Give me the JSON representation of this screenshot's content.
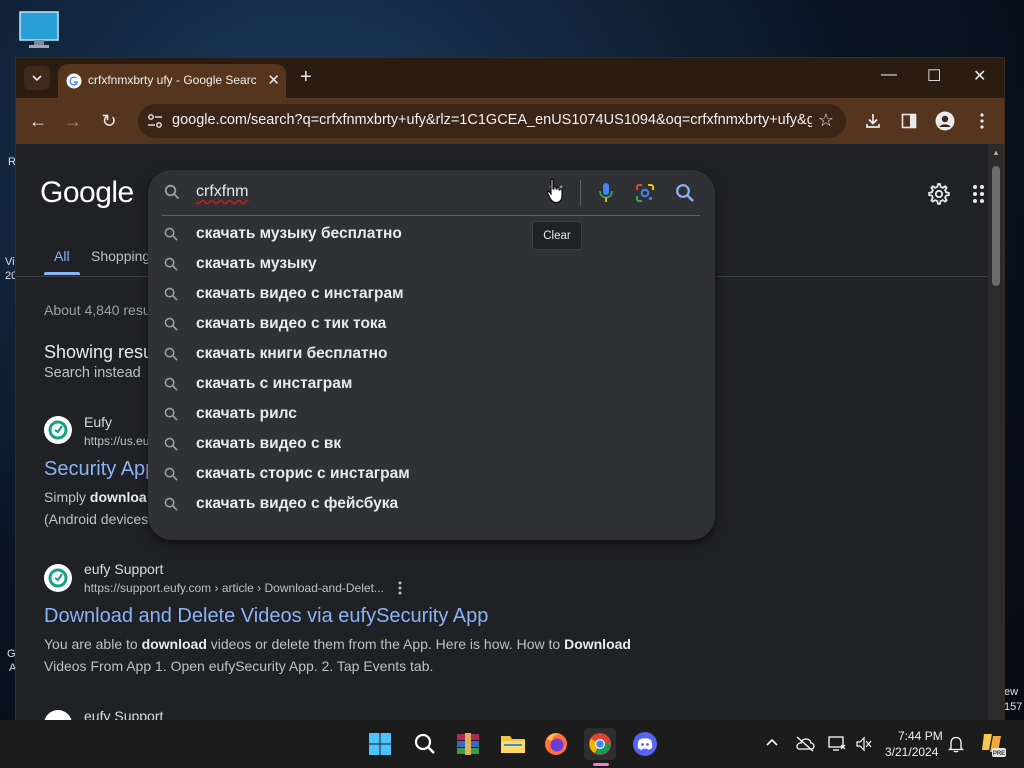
{
  "desktop": {
    "left_frags": [
      "R",
      "Vi",
      "20",
      "G",
      "A"
    ],
    "right_frags": [
      "ew",
      "157"
    ]
  },
  "browser": {
    "tab": {
      "title": "crfxfnmxbrty ufy - Google Search",
      "close": "✕"
    },
    "new_tab": "+",
    "window_controls": {
      "minimize": "—",
      "maximize": "☐",
      "close": "✕"
    },
    "toolbar": {
      "back": "←",
      "forward": "→",
      "reload": "↻",
      "url": "google.com/search?q=crfxfnmxbrty+ufy&rlz=1C1GCEA_enUS1074US1094&oq=crfxfnmxbrty+ufy&g...",
      "star": "☆"
    }
  },
  "google": {
    "logo": "Google",
    "tabs": {
      "all": "All",
      "shopping": "Shopping"
    },
    "results_count": "About 4,840 resu",
    "showing": "Showing resu",
    "search_instead": "Search instead",
    "results": [
      {
        "site": "Eufy",
        "url": "https://us.eu",
        "title": "Security App",
        "snippet_prefix": "Simply ",
        "snippet_bold": "downloa",
        "snippet_line2": "(Android devices"
      },
      {
        "site": "eufy Support",
        "url": "https://support.eufy.com › article › Download-and-Delet...",
        "title": "Download and Delete Videos via eufySecurity App",
        "line1": [
          "You are able to ",
          "download",
          " videos or delete them from the App. Here is how. How to ",
          "Download"
        ],
        "line2": "Videos From App 1. Open eufySecurity App. 2. Tap Events tab."
      },
      {
        "site": "eufy Support"
      }
    ]
  },
  "suggest": {
    "query": "crfxfnm",
    "clear_tooltip": "Clear",
    "items": [
      "скачать музыку бесплатно",
      "скачать музыку",
      "скачать видео с инстаграм",
      "скачать видео с тик тока",
      "скачать книги бесплатно",
      "скачать с инстаграм",
      "скачать рилс",
      "скачать видео с вк",
      "скачать сторис с инстаграм",
      "скачать видео с фейсбука"
    ]
  },
  "taskbar": {
    "time": "7:44 PM",
    "date": "3/21/2024"
  },
  "colors": {
    "link": "#8ab4f8",
    "tab_active": "#55351e",
    "page_bg": "#202124"
  }
}
